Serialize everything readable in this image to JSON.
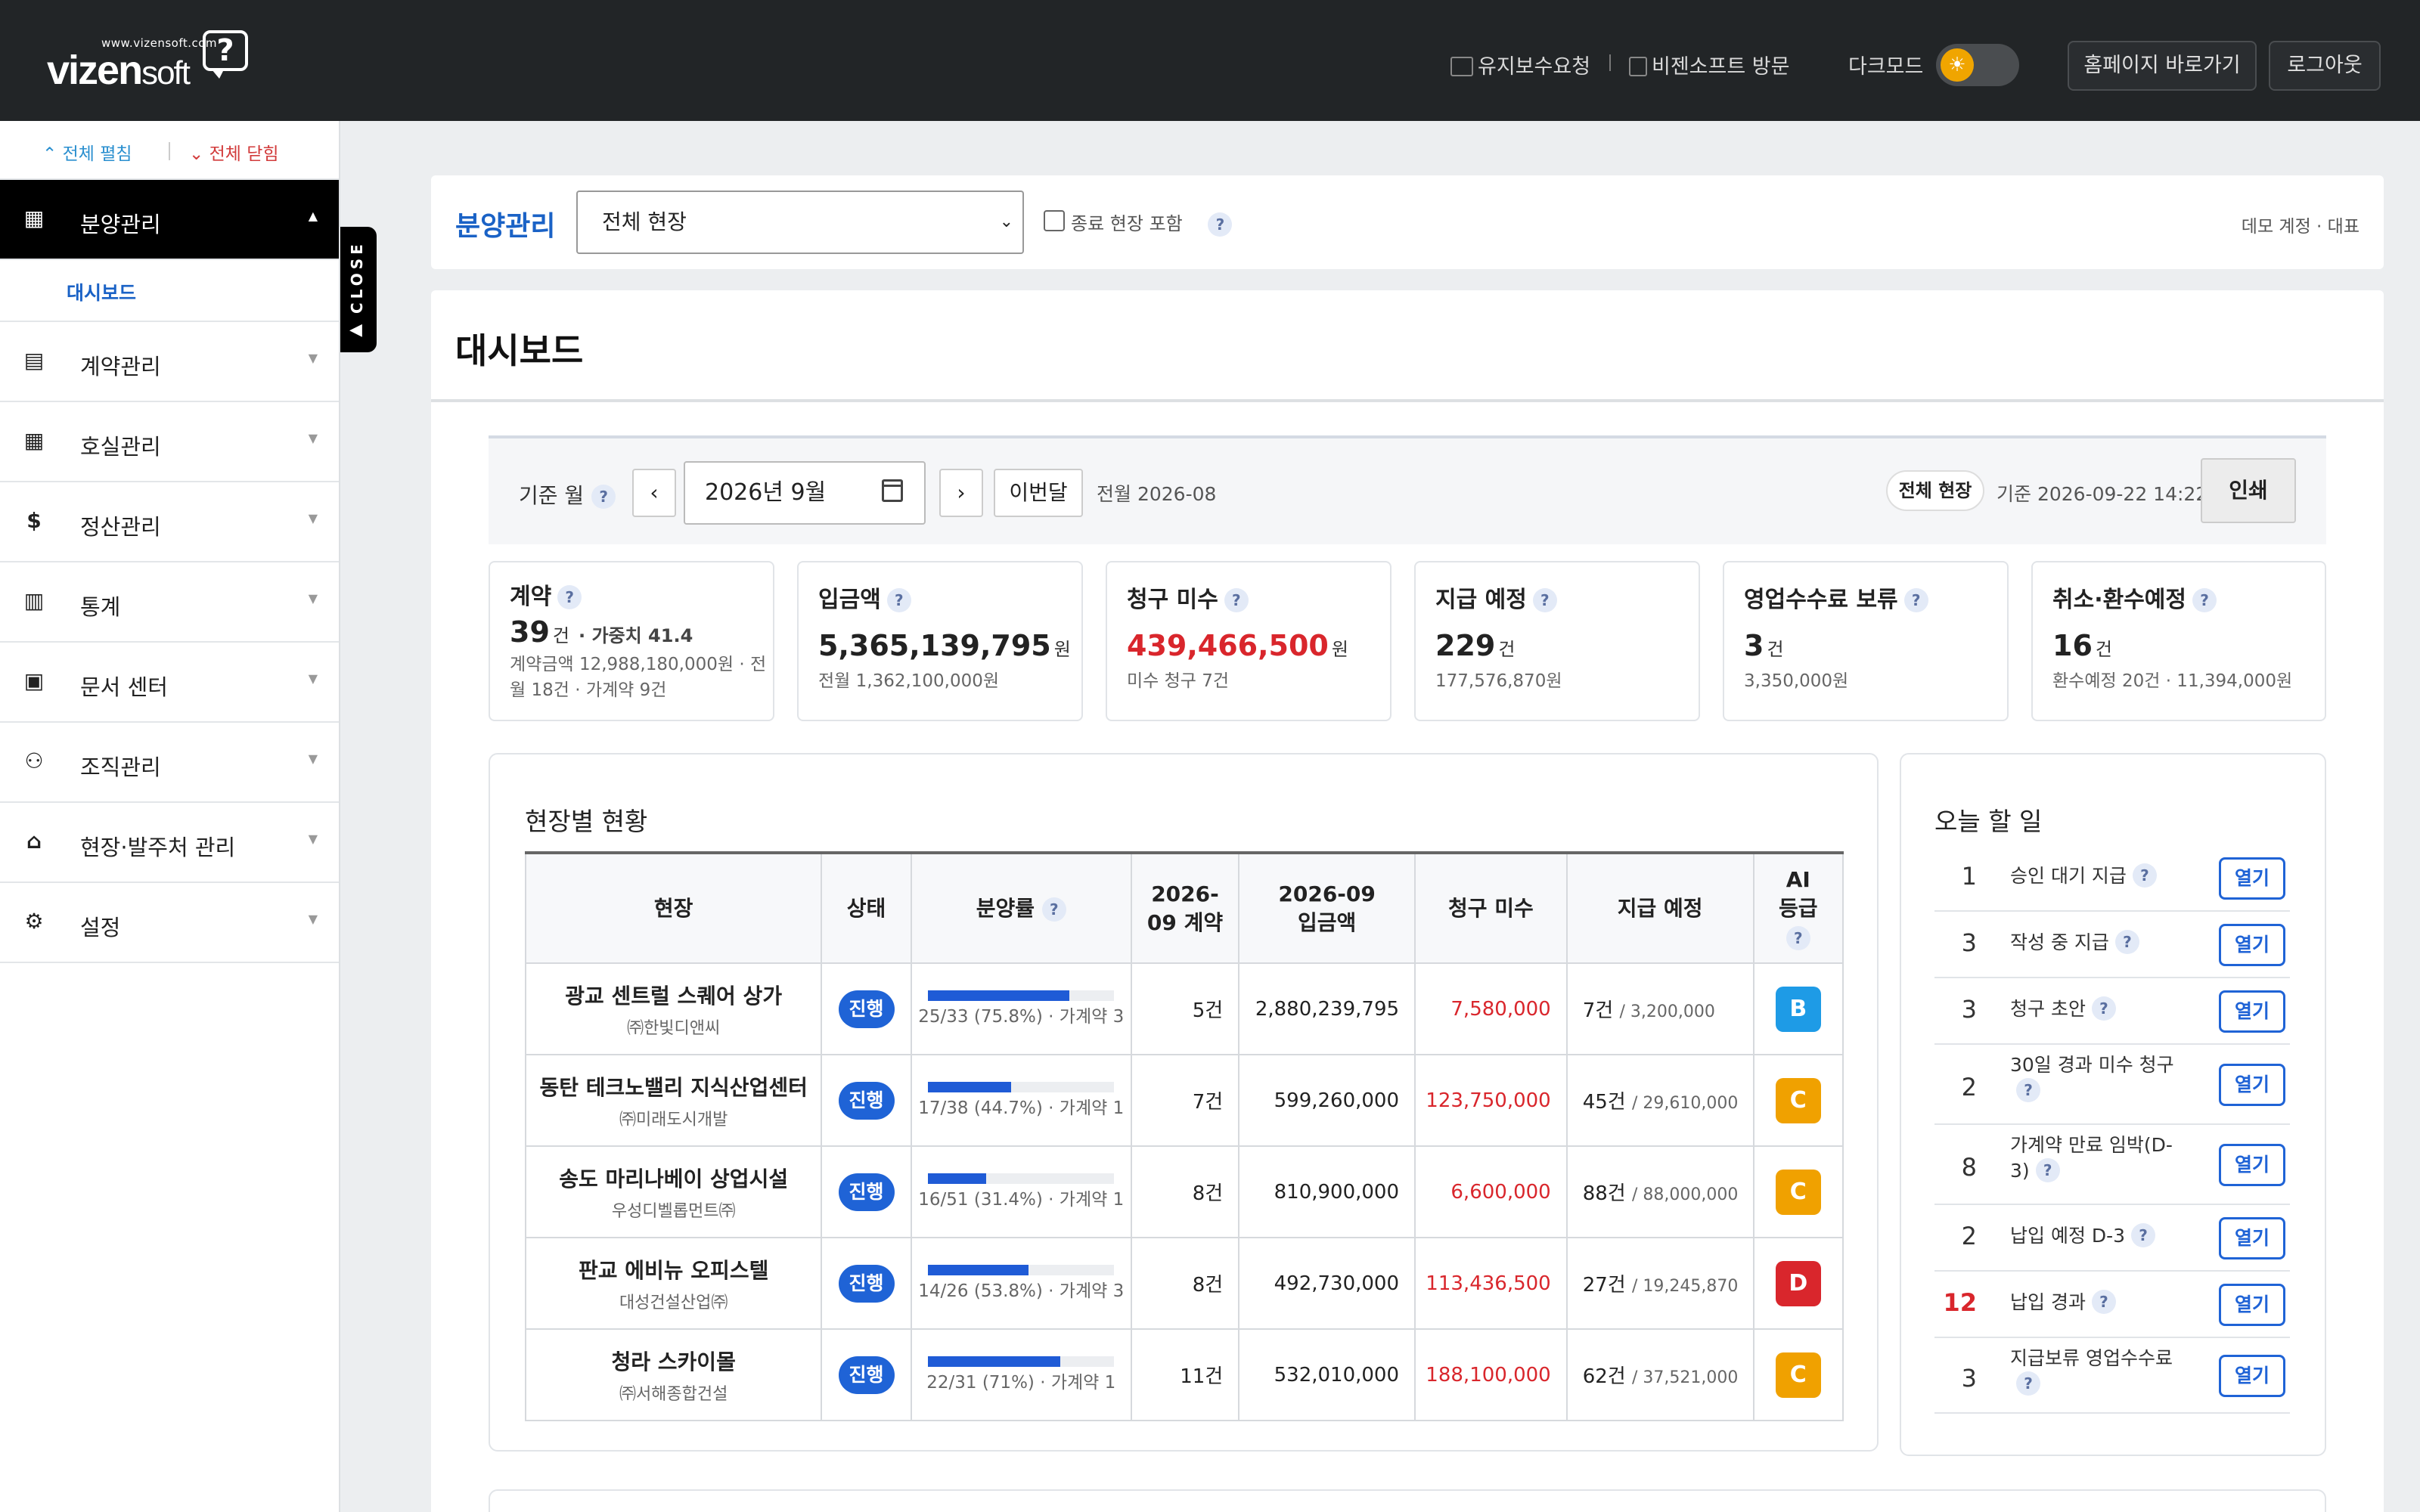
{
  "header": {
    "logo_small": "www.vizensoft.com",
    "logo_main": "vizen",
    "logo_soft": "soft",
    "logo_mark": "?",
    "link_maintenance": "유지보수요청",
    "link_visit": "비젠소프트 방문",
    "darkmode_label": "다크모드",
    "btn_homepage": "홈페이지 바로가기",
    "btn_logout": "로그아웃"
  },
  "sidebar": {
    "expand_all": "⌃ 전체 펼침",
    "collapse_all": "⌄ 전체 닫힘",
    "close_tab": "CLOSE",
    "items": [
      {
        "label": "분양관리",
        "icon": "building-icon",
        "glyph": "▦",
        "active": true,
        "sub": "대시보드"
      },
      {
        "label": "계약관리",
        "icon": "document-icon",
        "glyph": "▤"
      },
      {
        "label": "호실관리",
        "icon": "grid-icon",
        "glyph": "▦"
      },
      {
        "label": "정산관리",
        "icon": "dollar-icon",
        "glyph": "$"
      },
      {
        "label": "통계",
        "icon": "bar-chart-icon",
        "glyph": "▥"
      },
      {
        "label": "문서 센터",
        "icon": "pdf-icon",
        "glyph": "▣"
      },
      {
        "label": "조직관리",
        "icon": "people-icon",
        "glyph": "⚇"
      },
      {
        "label": "현장·발주처 관리",
        "icon": "bank-icon",
        "glyph": "⌂"
      },
      {
        "label": "설정",
        "icon": "settings-icon",
        "glyph": "⚙"
      }
    ]
  },
  "topfilter": {
    "title": "분양관리",
    "site_select": "전체 현장",
    "include_closed": "종료 현장 포함",
    "help": "?",
    "account": "데모 계정 · 대표"
  },
  "page": {
    "title": "대시보드"
  },
  "filterbar": {
    "month_label": "기준 월",
    "help": "?",
    "prev": "‹",
    "month_value": "2026년 9월",
    "next": "›",
    "this_month": "이번달",
    "prev_month": "전월 2026-08",
    "scope_pill": "전체 현장",
    "as_of": "기준 2026-09-22 14:22",
    "print": "인쇄"
  },
  "cards": [
    {
      "title": "계약",
      "value": "39",
      "unit": "건",
      "extra": "· 가중치 41.4",
      "sub": "계약금액 12,988,180,000원 · 전월 18건 · 가계약 9건"
    },
    {
      "title": "입금액",
      "value": "5,365,139,795",
      "unit": "원",
      "sub": "전월 1,362,100,000원"
    },
    {
      "title": "청구 미수",
      "value": "439,466,500",
      "unit": "원",
      "sub": "미수 청구 7건"
    },
    {
      "title": "지급 예정",
      "value": "229",
      "unit": "건",
      "sub": "177,576,870원"
    },
    {
      "title": "영업수수료 보류",
      "value": "3",
      "unit": "건",
      "sub": "3,350,000원"
    },
    {
      "title": "취소·환수예정",
      "value": "16",
      "unit": "건",
      "sub": "환수예정 20건 · 11,394,000원"
    }
  ],
  "sites": {
    "title": "현장별 현황",
    "headers": [
      "현장",
      "상태",
      "분양률",
      "2026-09 계약",
      "2026-09 입금액",
      "청구 미수",
      "지급 예정",
      "AI 등급"
    ],
    "rows": [
      {
        "name": "광교 센트럴 스퀘어 상가",
        "company": "㈜한빛디앤씨",
        "status": "진행",
        "rate": 0.758,
        "rate_text": "25/33 (75.8%) · 가계약 3",
        "contracts": "5건",
        "deposit": "2,880,239,795",
        "unpaid": "7,580,000",
        "pay_count": "7건",
        "pay_amount": "/ 3,200,000",
        "grade": "B",
        "grade_color": "#1e9be6"
      },
      {
        "name": "동탄 테크노밸리 지식산업센터",
        "company": "㈜미래도시개발",
        "status": "진행",
        "rate": 0.447,
        "rate_text": "17/38 (44.7%) · 가계약 1",
        "contracts": "7건",
        "deposit": "599,260,000",
        "unpaid": "123,750,000",
        "pay_count": "45건",
        "pay_amount": "/ 29,610,000",
        "grade": "C",
        "grade_color": "#f0a100"
      },
      {
        "name": "송도 마리나베이 상업시설",
        "company": "우성디벨롭먼트㈜",
        "status": "진행",
        "rate": 0.314,
        "rate_text": "16/51 (31.4%) · 가계약 1",
        "contracts": "8건",
        "deposit": "810,900,000",
        "unpaid": "6,600,000",
        "pay_count": "88건",
        "pay_amount": "/ 88,000,000",
        "grade": "C",
        "grade_color": "#f0a100"
      },
      {
        "name": "판교 에비뉴 오피스텔",
        "company": "대성건설산업㈜",
        "status": "진행",
        "rate": 0.538,
        "rate_text": "14/26 (53.8%) · 가계약 3",
        "contracts": "8건",
        "deposit": "492,730,000",
        "unpaid": "113,436,500",
        "pay_count": "27건",
        "pay_amount": "/ 19,245,870",
        "grade": "D",
        "grade_color": "#d9262c"
      },
      {
        "name": "청라 스카이몰",
        "company": "㈜서해종합건설",
        "status": "진행",
        "rate": 0.71,
        "rate_text": "22/31 (71%) · 가계약 1",
        "contracts": "11건",
        "deposit": "532,010,000",
        "unpaid": "188,100,000",
        "pay_count": "62건",
        "pay_amount": "/ 37,521,000",
        "grade": "C",
        "grade_color": "#f0a100"
      }
    ]
  },
  "todo": {
    "title": "오늘 할 일",
    "open": "열기",
    "items": [
      {
        "count": "1",
        "label": "승인 대기 지급"
      },
      {
        "count": "3",
        "label": "작성 중 지급"
      },
      {
        "count": "3",
        "label": "청구 초안"
      },
      {
        "count": "2",
        "label": "30일 경과 미수 청구"
      },
      {
        "count": "8",
        "label": "가계약 만료 임박(D-3)"
      },
      {
        "count": "2",
        "label": "납입 예정 D-3"
      },
      {
        "count": "12",
        "label": "납입 경과",
        "highlight": true
      },
      {
        "count": "3",
        "label": "지급보류 영업수수료"
      }
    ]
  },
  "colors": {
    "accent": "#1f63d6",
    "danger": "#d9262c",
    "topbar": "#222527"
  }
}
